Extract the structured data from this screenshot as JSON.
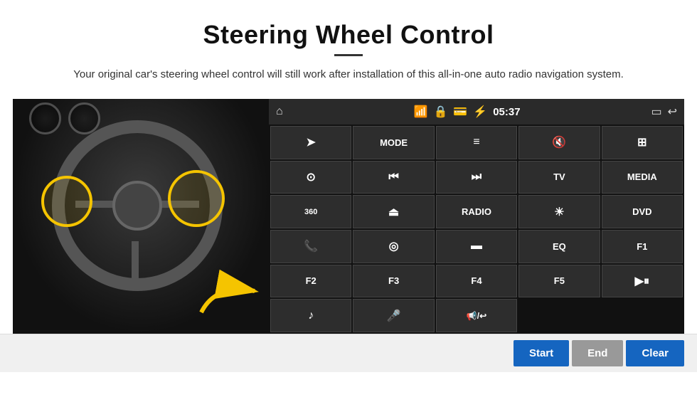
{
  "page": {
    "title": "Steering Wheel Control",
    "subtitle": "Your original car's steering wheel control will still work after installation of this all-in-one auto radio navigation system.",
    "divider": "—"
  },
  "topbar": {
    "time": "05:37",
    "wifi_icon": "wifi",
    "battery_icon": "battery",
    "bluetooth_icon": "bluetooth",
    "signal_icon": "signal",
    "home_icon": "home",
    "back_icon": "back",
    "screen_icon": "screen"
  },
  "grid_buttons": [
    {
      "id": "r1c1",
      "type": "icon",
      "label": "navigate",
      "symbol": "➤"
    },
    {
      "id": "r1c2",
      "type": "text",
      "label": "mode-btn",
      "symbol": "MODE"
    },
    {
      "id": "r1c3",
      "type": "icon",
      "label": "list-btn",
      "symbol": "≡"
    },
    {
      "id": "r1c4",
      "type": "icon",
      "label": "mute-btn",
      "symbol": "🔇"
    },
    {
      "id": "r1c5",
      "type": "icon",
      "label": "apps-btn",
      "symbol": "⊞"
    },
    {
      "id": "r2c1",
      "type": "icon",
      "label": "settings-btn",
      "symbol": "⊙"
    },
    {
      "id": "r2c2",
      "type": "icon",
      "label": "prev-btn",
      "symbol": "⏮"
    },
    {
      "id": "r2c3",
      "type": "icon",
      "label": "next-btn",
      "symbol": "⏭"
    },
    {
      "id": "r2c4",
      "type": "text",
      "label": "tv-btn",
      "symbol": "TV"
    },
    {
      "id": "r2c5",
      "type": "text",
      "label": "media-btn",
      "symbol": "MEDIA"
    },
    {
      "id": "r3c1",
      "type": "icon",
      "label": "360cam-btn",
      "symbol": "360"
    },
    {
      "id": "r3c2",
      "type": "icon",
      "label": "eject-btn",
      "symbol": "⏏"
    },
    {
      "id": "r3c3",
      "type": "text",
      "label": "radio-btn",
      "symbol": "RADIO"
    },
    {
      "id": "r3c4",
      "type": "icon",
      "label": "brightness-btn",
      "symbol": "☀"
    },
    {
      "id": "r3c5",
      "type": "text",
      "label": "dvd-btn",
      "symbol": "DVD"
    },
    {
      "id": "r4c1",
      "type": "icon",
      "label": "phone-btn",
      "symbol": "📞"
    },
    {
      "id": "r4c2",
      "type": "icon",
      "label": "internet-btn",
      "symbol": "◎"
    },
    {
      "id": "r4c3",
      "type": "icon",
      "label": "screen2-btn",
      "symbol": "▬"
    },
    {
      "id": "r4c4",
      "type": "text",
      "label": "eq-btn",
      "symbol": "EQ"
    },
    {
      "id": "r4c5",
      "type": "text",
      "label": "f1-btn",
      "symbol": "F1"
    },
    {
      "id": "r5c1",
      "type": "text",
      "label": "f2-btn",
      "symbol": "F2"
    },
    {
      "id": "r5c2",
      "type": "text",
      "label": "f3-btn",
      "symbol": "F3"
    },
    {
      "id": "r5c3",
      "type": "text",
      "label": "f4-btn",
      "symbol": "F4"
    },
    {
      "id": "r5c4",
      "type": "text",
      "label": "f5-btn",
      "symbol": "F5"
    },
    {
      "id": "r5c5",
      "type": "icon",
      "label": "playpause-btn",
      "symbol": "▶⏸"
    },
    {
      "id": "r6c1",
      "type": "icon",
      "label": "music-btn",
      "symbol": "♪"
    },
    {
      "id": "r6c2",
      "type": "icon",
      "label": "mic-btn",
      "symbol": "🎤"
    },
    {
      "id": "r6c3",
      "type": "icon",
      "label": "volphone-btn",
      "symbol": "📢"
    }
  ],
  "bottom_bar": {
    "start_label": "Start",
    "end_label": "End",
    "clear_label": "Clear"
  }
}
